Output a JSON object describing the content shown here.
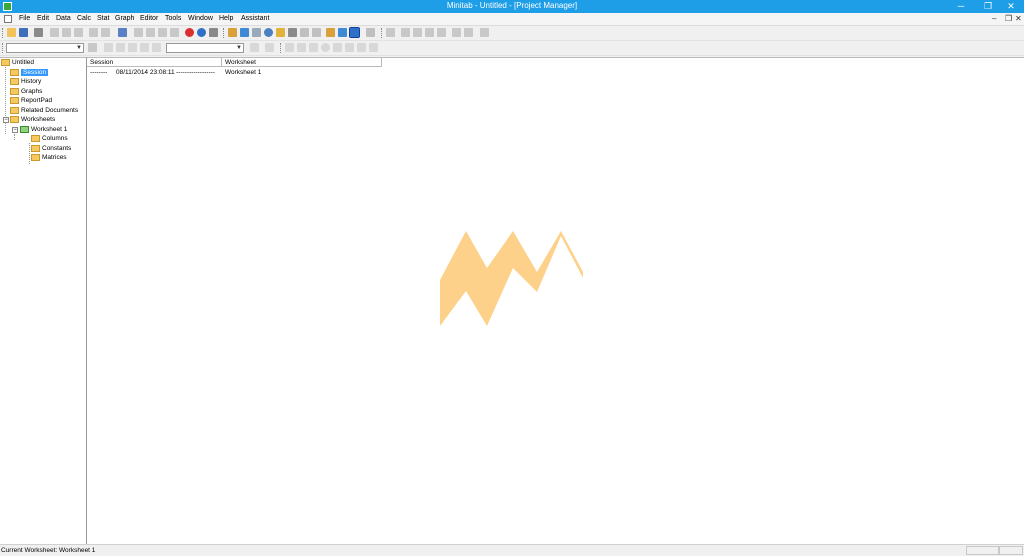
{
  "window": {
    "title": "Minitab - Untitled - [Project Manager]",
    "minimize": "─",
    "maximize": "❐",
    "close": "✕"
  },
  "menu": {
    "items": [
      "File",
      "Edit",
      "Data",
      "Calc",
      "Stat",
      "Graph",
      "Editor",
      "Tools",
      "Window",
      "Help",
      "Assistant"
    ],
    "mdi_minimize": "–",
    "mdi_restore": "❐",
    "mdi_close": "✕"
  },
  "tree": {
    "root": "Untitled",
    "session": "Session",
    "history": "History",
    "graphs": "Graphs",
    "reportpad": "ReportPad",
    "related_documents": "Related Documents",
    "worksheets": "Worksheets",
    "worksheet1": "Worksheet 1",
    "columns": "Columns",
    "constants": "Constants",
    "matrices": "Matrices",
    "collapse_symbol": "−"
  },
  "table": {
    "headers": [
      "Session",
      "Worksheet"
    ],
    "row": {
      "session_prefix": "--------",
      "timestamp": "08/11/2014 23:08:11",
      "session_suffix": "------------------",
      "worksheet": "Worksheet 1"
    }
  },
  "status": {
    "text": "Current Worksheet: Worksheet 1"
  },
  "colors": {
    "titlebar": "#1f9ee8",
    "selection": "#3399ff",
    "watermark": "#fdd18a",
    "folder": "#f5c860"
  }
}
